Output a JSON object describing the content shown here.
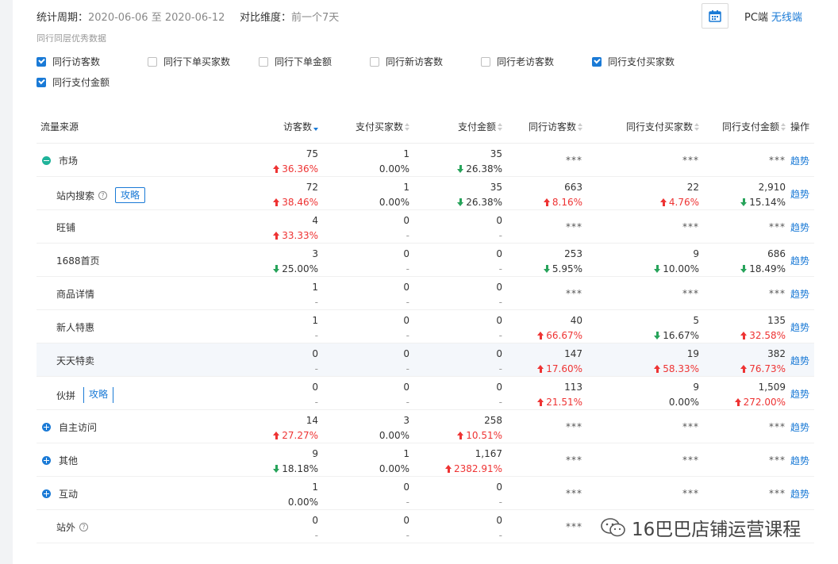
{
  "header": {
    "period_label": "统计周期：",
    "period_value": "2020-06-06 至 2020-06-12",
    "compare_label": "对比维度：",
    "compare_value": "前一个7天",
    "device_pc": "PC端",
    "device_wireless": "无线端",
    "active_device": "无线端"
  },
  "peer": {
    "section_title": "同行同层优秀数据",
    "checkboxes": [
      {
        "label": "同行访客数",
        "checked": true
      },
      {
        "label": "同行下单买家数",
        "checked": false
      },
      {
        "label": "同行下单金额",
        "checked": false
      },
      {
        "label": "同行新访客数",
        "checked": false
      },
      {
        "label": "同行老访客数",
        "checked": false
      },
      {
        "label": "同行支付买家数",
        "checked": true
      },
      {
        "label": "同行支付金额",
        "checked": true
      }
    ]
  },
  "table": {
    "columns": [
      "流量来源",
      "访客数",
      "支付买家数",
      "支付金额",
      "同行访客数",
      "同行支付买家数",
      "同行支付金额",
      "操作"
    ],
    "sort_column": "访客数",
    "sort_direction": "desc",
    "action_label": "趋势",
    "rows": [
      {
        "name": "市场",
        "level": 0,
        "expander": "minus",
        "help": false,
        "tag": "",
        "cells": [
          {
            "v": "75",
            "d": "36.36%",
            "dir": "up"
          },
          {
            "v": "1",
            "d": "0.00%",
            "dir": "flat"
          },
          {
            "v": "35",
            "d": "26.38%",
            "dir": "down"
          },
          {
            "stars": "***"
          },
          {
            "stars": "***"
          },
          {
            "stars": "***"
          }
        ]
      },
      {
        "name": "站内搜索",
        "level": 1,
        "expander": "",
        "help": true,
        "tag": "攻略",
        "cells": [
          {
            "v": "72",
            "d": "38.46%",
            "dir": "up"
          },
          {
            "v": "1",
            "d": "0.00%",
            "dir": "flat"
          },
          {
            "v": "35",
            "d": "26.38%",
            "dir": "down"
          },
          {
            "v": "663",
            "d": "8.16%",
            "dir": "up"
          },
          {
            "v": "22",
            "d": "4.76%",
            "dir": "up"
          },
          {
            "v": "2,910",
            "d": "15.14%",
            "dir": "down"
          }
        ]
      },
      {
        "name": "旺铺",
        "level": 1,
        "expander": "",
        "help": false,
        "tag": "",
        "cells": [
          {
            "v": "4",
            "d": "33.33%",
            "dir": "up"
          },
          {
            "v": "0",
            "d": "-",
            "dir": "dash"
          },
          {
            "v": "0",
            "d": "-",
            "dir": "dash"
          },
          {
            "stars": "***"
          },
          {
            "stars": "***"
          },
          {
            "stars": "***"
          }
        ]
      },
      {
        "name": "1688首页",
        "level": 1,
        "expander": "",
        "help": false,
        "tag": "",
        "cells": [
          {
            "v": "3",
            "d": "25.00%",
            "dir": "down"
          },
          {
            "v": "0",
            "d": "-",
            "dir": "dash"
          },
          {
            "v": "0",
            "d": "-",
            "dir": "dash"
          },
          {
            "v": "253",
            "d": "5.95%",
            "dir": "down"
          },
          {
            "v": "9",
            "d": "10.00%",
            "dir": "down"
          },
          {
            "v": "686",
            "d": "18.49%",
            "dir": "down"
          }
        ]
      },
      {
        "name": "商品详情",
        "level": 1,
        "expander": "",
        "help": false,
        "tag": "",
        "cells": [
          {
            "v": "1",
            "d": "-",
            "dir": "dash"
          },
          {
            "v": "0",
            "d": "-",
            "dir": "dash"
          },
          {
            "v": "0",
            "d": "-",
            "dir": "dash"
          },
          {
            "stars": "***"
          },
          {
            "stars": "***"
          },
          {
            "stars": "***"
          }
        ]
      },
      {
        "name": "新人特惠",
        "level": 1,
        "expander": "",
        "help": false,
        "tag": "",
        "cells": [
          {
            "v": "1",
            "d": "-",
            "dir": "dash"
          },
          {
            "v": "0",
            "d": "-",
            "dir": "dash"
          },
          {
            "v": "0",
            "d": "-",
            "dir": "dash"
          },
          {
            "v": "40",
            "d": "66.67%",
            "dir": "up"
          },
          {
            "v": "5",
            "d": "16.67%",
            "dir": "down"
          },
          {
            "v": "135",
            "d": "32.58%",
            "dir": "up"
          }
        ]
      },
      {
        "name": "天天特卖",
        "level": 1,
        "expander": "",
        "help": false,
        "tag": "",
        "highlight": true,
        "cells": [
          {
            "v": "0",
            "d": "-",
            "dir": "dash"
          },
          {
            "v": "0",
            "d": "-",
            "dir": "dash"
          },
          {
            "v": "0",
            "d": "-",
            "dir": "dash"
          },
          {
            "v": "147",
            "d": "17.60%",
            "dir": "up"
          },
          {
            "v": "19",
            "d": "58.33%",
            "dir": "up"
          },
          {
            "v": "382",
            "d": "76.73%",
            "dir": "up"
          }
        ]
      },
      {
        "name": "伙拼",
        "level": 1,
        "expander": "",
        "help": false,
        "tag": "攻略",
        "tag_split": true,
        "cells": [
          {
            "v": "0",
            "d": "-",
            "dir": "dash"
          },
          {
            "v": "0",
            "d": "-",
            "dir": "dash"
          },
          {
            "v": "0",
            "d": "-",
            "dir": "dash"
          },
          {
            "v": "113",
            "d": "21.51%",
            "dir": "up"
          },
          {
            "v": "9",
            "d": "0.00%",
            "dir": "flat"
          },
          {
            "v": "1,509",
            "d": "272.00%",
            "dir": "up"
          }
        ]
      },
      {
        "name": "自主访问",
        "level": 0,
        "expander": "plus",
        "help": false,
        "tag": "",
        "cells": [
          {
            "v": "14",
            "d": "27.27%",
            "dir": "up"
          },
          {
            "v": "3",
            "d": "0.00%",
            "dir": "flat"
          },
          {
            "v": "258",
            "d": "10.51%",
            "dir": "up"
          },
          {
            "stars": "***"
          },
          {
            "stars": "***"
          },
          {
            "stars": "***"
          }
        ]
      },
      {
        "name": "其他",
        "level": 0,
        "expander": "plus",
        "help": false,
        "tag": "",
        "cells": [
          {
            "v": "9",
            "d": "18.18%",
            "dir": "down"
          },
          {
            "v": "1",
            "d": "0.00%",
            "dir": "flat"
          },
          {
            "v": "1,167",
            "d": "2382.91%",
            "dir": "up"
          },
          {
            "stars": "***"
          },
          {
            "stars": "***"
          },
          {
            "stars": "***"
          }
        ]
      },
      {
        "name": "互动",
        "level": 0,
        "expander": "plus",
        "help": false,
        "tag": "",
        "cells": [
          {
            "v": "1",
            "d": "0.00%",
            "dir": "flat"
          },
          {
            "v": "0",
            "d": "-",
            "dir": "dash"
          },
          {
            "v": "0",
            "d": "-",
            "dir": "dash"
          },
          {
            "stars": "***"
          },
          {
            "stars": "***"
          },
          {
            "stars": "***"
          }
        ]
      },
      {
        "name": "站外",
        "level": 1,
        "expander": "",
        "help": true,
        "tag": "",
        "cells": [
          {
            "v": "0",
            "d": "-",
            "dir": "dash"
          },
          {
            "v": "0",
            "d": "-",
            "dir": "dash"
          },
          {
            "v": "0",
            "d": "-",
            "dir": "dash"
          },
          {
            "stars": "***"
          }
        ]
      }
    ]
  },
  "watermark": {
    "text": "16巴巴店铺运营课程"
  },
  "colors": {
    "accent": "#1a7ad6",
    "up": "#e33333",
    "down": "#27a35a",
    "expander_minus": "#1fb39a"
  }
}
